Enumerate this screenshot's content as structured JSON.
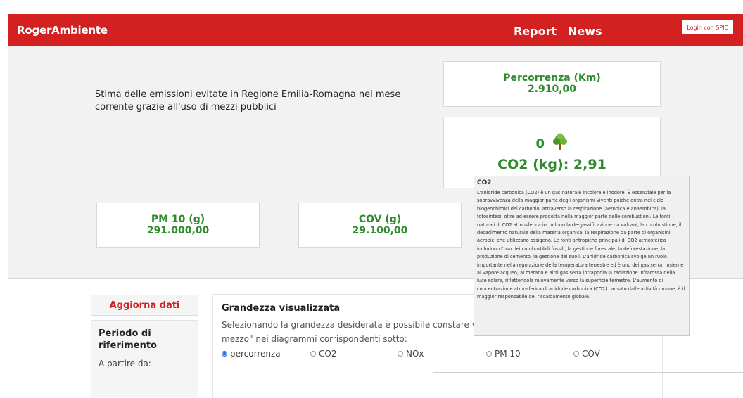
{
  "header": {
    "brand": "RogerAmbiente",
    "nav": [
      "Report",
      "News"
    ],
    "login": "Login con SPID",
    "colors": {
      "brand_red": "#d32020",
      "value_green": "#2e8b2e"
    }
  },
  "intro": "Stima delle emissioni evitate in Regione Emilia-Romagna nel mese corrente grazie all'uso di mezzi pubblici",
  "cards": {
    "percorrenza": {
      "label": "Percorrenza (Km)",
      "value": "2.910,00"
    },
    "co2": {
      "count": "0",
      "icon": "tree-icon",
      "line": "CO2 (kg): 2,91"
    },
    "pm10": {
      "label": "PM 10 (g)",
      "value": "291.000,00"
    },
    "cov": {
      "label": "COV (g)",
      "value": "29.100,00"
    }
  },
  "tooltip": {
    "title": "CO2",
    "body": "L'anidride carbonica (CO2) è un gas naturale incolore e inodore. È essenziale per la sopravvivenza della maggior parte degli organismi viventi poichè entra nel ciclo biogeochimici del carbonio, attraverso la respirazione (aerobica e anaerobica), la fotosintesi, oltre ad essere prodotta nella maggior parte delle combustioni. Le fonti naturali di CO2 atmosferica includono la de-gassificazione da vulcani, la combustione, il decadimento naturale della materia organica, la respirazione da parte di organismi aerobici che utilizzano ossigeno. Le fonti antropiche principali di CO2 atmosferica includono l'uso dei combustibili fossili, la gestione forestale, la deforestazione, la produzione di cemento, la gestione dei suoli. L'anidride carbonica svolge un ruolo importante nella regolazione della temperatura terrestre ed è uno dei gas serra. Insieme al vapore acqueo, al metano e altri gas serra intrappola la radiazione infrarossa della luce solare, riflettendola nuovamente verso la superficie terrestre. L'aumento di concentrazione atmosferica di anidride carbonica (CO2) causato dalle attività umane, è il maggior responsabile del riscaldamento globale."
  },
  "sidebar": {
    "refresh": "Aggiorna dati",
    "period_title": "Periodo di riferimento",
    "from_label": "A partire da:"
  },
  "panel": {
    "title": "Grandezza visualizzata",
    "desc1": "Selezionando la grandezza desiderata è possibile constare visiva",
    "desc2": "mezzo\" nei diagrammi corrispondenti sotto:",
    "options": [
      "percorrenza",
      "CO2",
      "NOx",
      "PM 10",
      "COV"
    ],
    "selected": "percorrenza"
  }
}
